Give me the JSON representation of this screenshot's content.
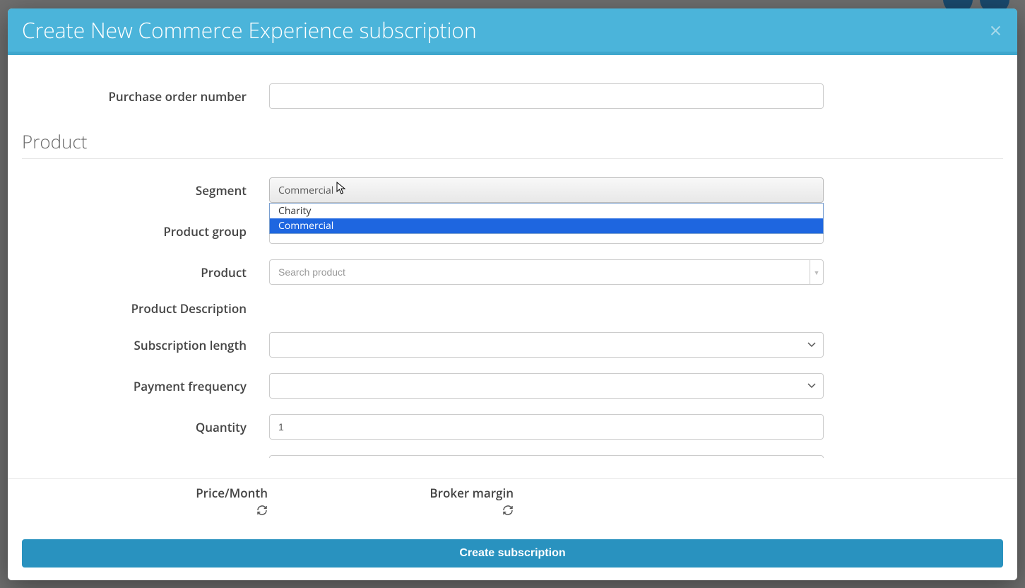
{
  "modal": {
    "title": "Create New Commerce Experience subscription",
    "close_symbol": "×"
  },
  "fields": {
    "purchase_order": {
      "label": "Purchase order number",
      "value": ""
    },
    "segment": {
      "label": "Segment",
      "selected": "Commercial",
      "options": [
        "Charity",
        "Commercial"
      ],
      "highlighted_index": 1
    },
    "product_group": {
      "label": "Product group"
    },
    "product": {
      "label": "Product",
      "placeholder": "Search product"
    },
    "product_description": {
      "label": "Product Description"
    },
    "subscription_length": {
      "label": "Subscription length"
    },
    "payment_frequency": {
      "label": "Payment frequency"
    },
    "quantity": {
      "label": "Quantity",
      "value": "1"
    }
  },
  "section": {
    "product_heading": "Product"
  },
  "footer": {
    "price_label": "Price/Month",
    "broker_margin_label": "Broker margin",
    "create_button": "Create subscription"
  }
}
